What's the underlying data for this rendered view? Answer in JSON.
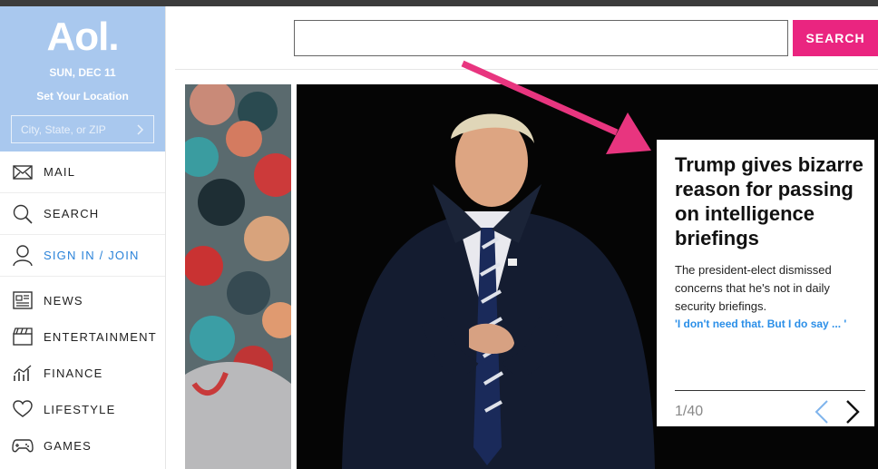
{
  "brand": {
    "logo": "Aol.",
    "date": "SUN, DEC 11",
    "set_location": "Set Your Location",
    "location_placeholder": "City, State, or ZIP"
  },
  "nav": [
    {
      "label": "MAIL",
      "icon": "mail-icon"
    },
    {
      "label": "SEARCH",
      "icon": "search-icon"
    },
    {
      "label": "SIGN IN / JOIN",
      "icon": "user-icon"
    },
    {
      "label": "NEWS",
      "icon": "newspaper-icon"
    },
    {
      "label": "ENTERTAINMENT",
      "icon": "clapperboard-icon"
    },
    {
      "label": "FINANCE",
      "icon": "chart-icon"
    },
    {
      "label": "LIFESTYLE",
      "icon": "heart-icon"
    },
    {
      "label": "GAMES",
      "icon": "gamepad-icon"
    }
  ],
  "search": {
    "button_label": "SEARCH",
    "value": ""
  },
  "story": {
    "headline": "Trump gives bizarre reason for passing on intelligence briefings",
    "summary": "The president-elect dismissed concerns that he's not in daily security briefings.",
    "link": "'I don't need that. But I do say ... '",
    "counter": "1/40"
  },
  "colors": {
    "brand_bg": "#a9c8ee",
    "accent": "#ea2580",
    "link": "#2b83d9"
  }
}
